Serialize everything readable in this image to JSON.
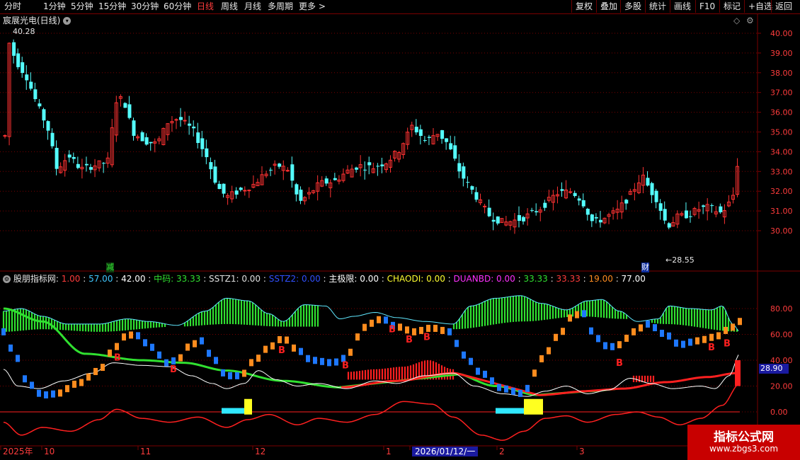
{
  "toolbar": {
    "periods": [
      "分时",
      "1分钟",
      "5分钟",
      "15分钟",
      "30分钟",
      "60分钟",
      "日线",
      "周线",
      "月线",
      "多周期",
      "更多"
    ],
    "active_period": "日线",
    "right_buttons": [
      "复权",
      "叠加",
      "多股",
      "统计",
      "画线",
      "F10",
      "标记",
      "+自选",
      "返回"
    ]
  },
  "stock": {
    "title": "宸展光电(日线)",
    "high_mark": "40.28",
    "low_mark": "28.55",
    "marker_jian": "减",
    "marker_cai": "财"
  },
  "price_axis": [
    "40.00",
    "39.00",
    "38.00",
    "37.00",
    "36.00",
    "35.00",
    "34.00",
    "33.00",
    "32.00",
    "31.00",
    "30.00"
  ],
  "indicator": {
    "name": "股朋指标网",
    "values": [
      {
        "text": "1.00",
        "color": "#ff3c3c"
      },
      {
        "text": "57.00",
        "color": "#40c8ff"
      },
      {
        "text": "42.00",
        "color": "#ffffff"
      },
      {
        "text": "中码: 33.33",
        "color": "#30e030"
      },
      {
        "text": "SSTZ1: 0.00",
        "color": "#e0e0e0"
      },
      {
        "text": "SSTZ2: 0.00",
        "color": "#3050ff"
      },
      {
        "text": "主极限: 0.00",
        "color": "#ffffff"
      },
      {
        "text": "CHAODI: 0.00",
        "color": "#ffff30"
      },
      {
        "text": "DUANBD: 0.00",
        "color": "#ff30ff"
      },
      {
        "text": "33.33",
        "color": "#30e030"
      },
      {
        "text": "33.33",
        "color": "#ff3c3c"
      },
      {
        "text": "19.00",
        "color": "#ff8c20"
      },
      {
        "text": "77.00",
        "color": "#ffffff"
      }
    ],
    "axis": [
      "80.00",
      "60.00",
      "40.00",
      "20.00",
      "0.00"
    ],
    "current_value": "28.90",
    "buy_label": "B"
  },
  "date_axis": {
    "labels": [
      "2025年",
      "10",
      "11",
      "12",
      "1",
      "2026/01/12/一",
      "2",
      "3"
    ]
  },
  "watermark": {
    "line1": "指标公式网",
    "line2": "www.zbgs3.com"
  },
  "colors": {
    "up": "#ff3232",
    "down": "#54ffff",
    "grid": "#7a0000",
    "axis_text": "#ff3c3c"
  }
}
